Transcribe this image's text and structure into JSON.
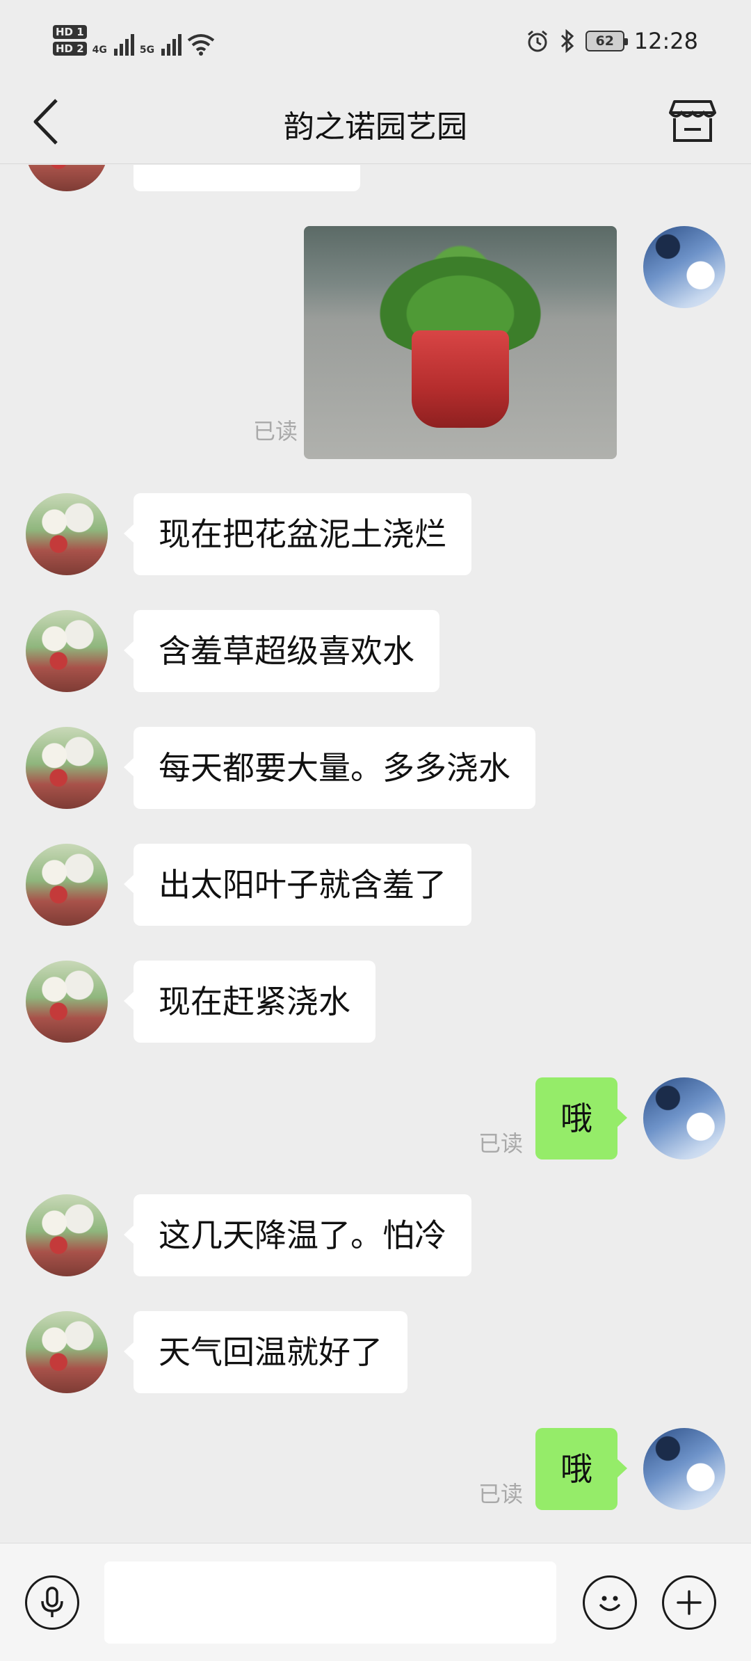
{
  "status_bar": {
    "hd1": "HD 1",
    "hd2": "HD 2",
    "net1": "4G",
    "net2": "5G",
    "battery": "62",
    "time": "12:28",
    "icons": [
      "signal-icon",
      "wifi-icon",
      "alarm-icon",
      "bluetooth-icon",
      "battery-icon"
    ]
  },
  "header": {
    "title": "韵之诺园艺园",
    "back_icon": "chevron-left-icon",
    "shop_icon": "shop-icon"
  },
  "chat": {
    "read_label": "已读",
    "messages": [
      {
        "from": "other",
        "text": "现在把花盆泥土浇烂"
      },
      {
        "from": "other",
        "text": "含羞草超级喜欢水"
      },
      {
        "from": "other",
        "text": "每天都要大量。多多浇水"
      },
      {
        "from": "other",
        "text": "出太阳叶子就含羞了"
      },
      {
        "from": "other",
        "text": "现在赶紧浇水"
      },
      {
        "from": "me",
        "text": "哦",
        "status": "已读"
      },
      {
        "from": "other",
        "text": "这几天降温了。怕冷"
      },
      {
        "from": "other",
        "text": "天气回温就好了"
      },
      {
        "from": "me",
        "text": "哦",
        "status": "已读"
      }
    ]
  },
  "input_bar": {
    "placeholder": "",
    "voice_icon": "microphone-icon",
    "emoji_icon": "smiley-icon",
    "plus_icon": "plus-icon"
  },
  "colors": {
    "background": "#ededed",
    "my_bubble": "#95ec69",
    "other_bubble": "#ffffff",
    "read_text": "#a9a9a9"
  }
}
